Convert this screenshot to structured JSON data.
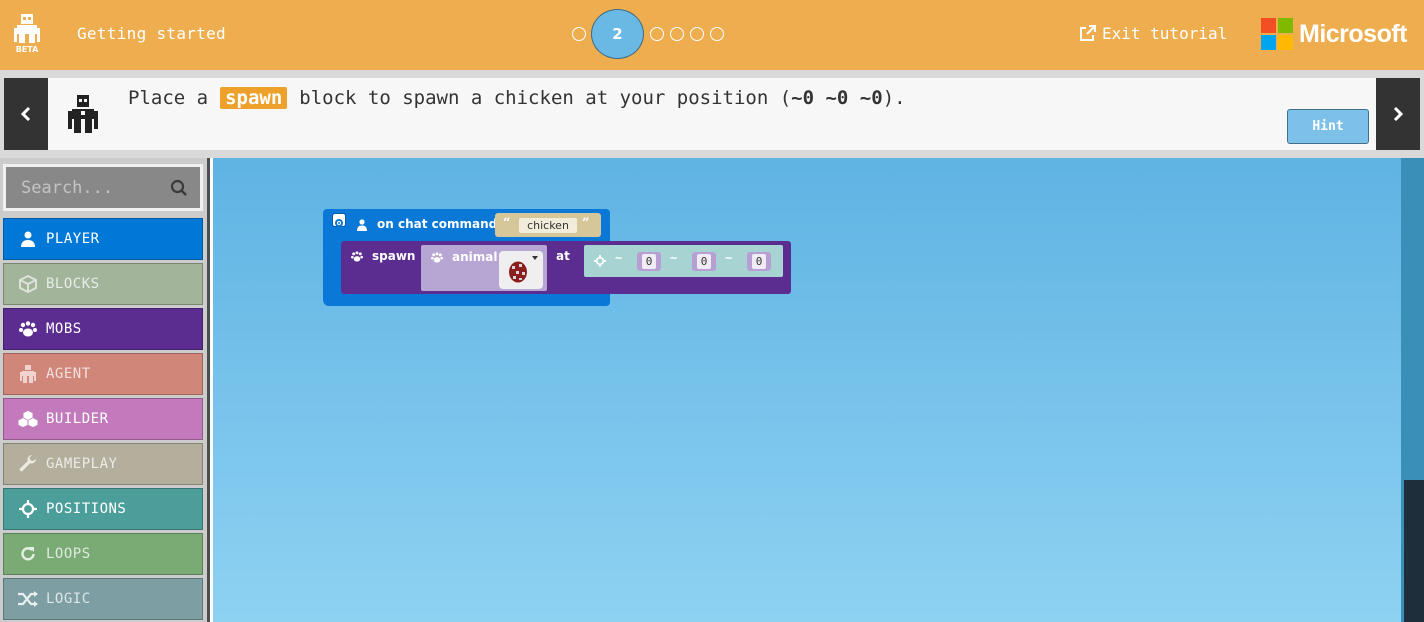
{
  "header": {
    "beta_label": "BETA",
    "title": "Getting started",
    "current_step": "2",
    "exit_label": "Exit tutorial",
    "brand": "Microsoft",
    "brand_colors": [
      "#f25022",
      "#7fba00",
      "#00a4ef",
      "#ffb900"
    ]
  },
  "instruction": {
    "text_before": "Place a",
    "keyword": "spawn",
    "text_middle": "block to spawn a chicken at your position (",
    "code": "~0 ~0 ~0",
    "text_after": ").",
    "hint_label": "Hint"
  },
  "toolbox": {
    "search_placeholder": "Search...",
    "categories": [
      {
        "label": "PLAYER",
        "color": "#0078d7",
        "icon": "person-icon"
      },
      {
        "label": "BLOCKS",
        "color": "#a2b49a",
        "icon": "cube-icon"
      },
      {
        "label": "MOBS",
        "color": "#5c2d91",
        "icon": "paw-icon"
      },
      {
        "label": "AGENT",
        "color": "#d1867a",
        "icon": "agent-icon"
      },
      {
        "label": "BUILDER",
        "color": "#c27abd",
        "icon": "cubes-icon"
      },
      {
        "label": "GAMEPLAY",
        "color": "#b4ae9c",
        "icon": "wrench-icon"
      },
      {
        "label": "POSITIONS",
        "color": "#4b9e9a",
        "icon": "crosshair-icon"
      },
      {
        "label": "LOOPS",
        "color": "#7bab75",
        "icon": "refresh-icon"
      },
      {
        "label": "LOGIC",
        "color": "#7d9ea3",
        "icon": "shuffle-icon"
      }
    ]
  },
  "workspace": {
    "event_block": {
      "label": "on chat command",
      "argument": "chicken"
    },
    "spawn_block": {
      "label": "spawn",
      "animal_label": "animal",
      "at_label": "at",
      "position": [
        "~",
        "0",
        "~",
        "0",
        "~",
        "0"
      ]
    }
  }
}
